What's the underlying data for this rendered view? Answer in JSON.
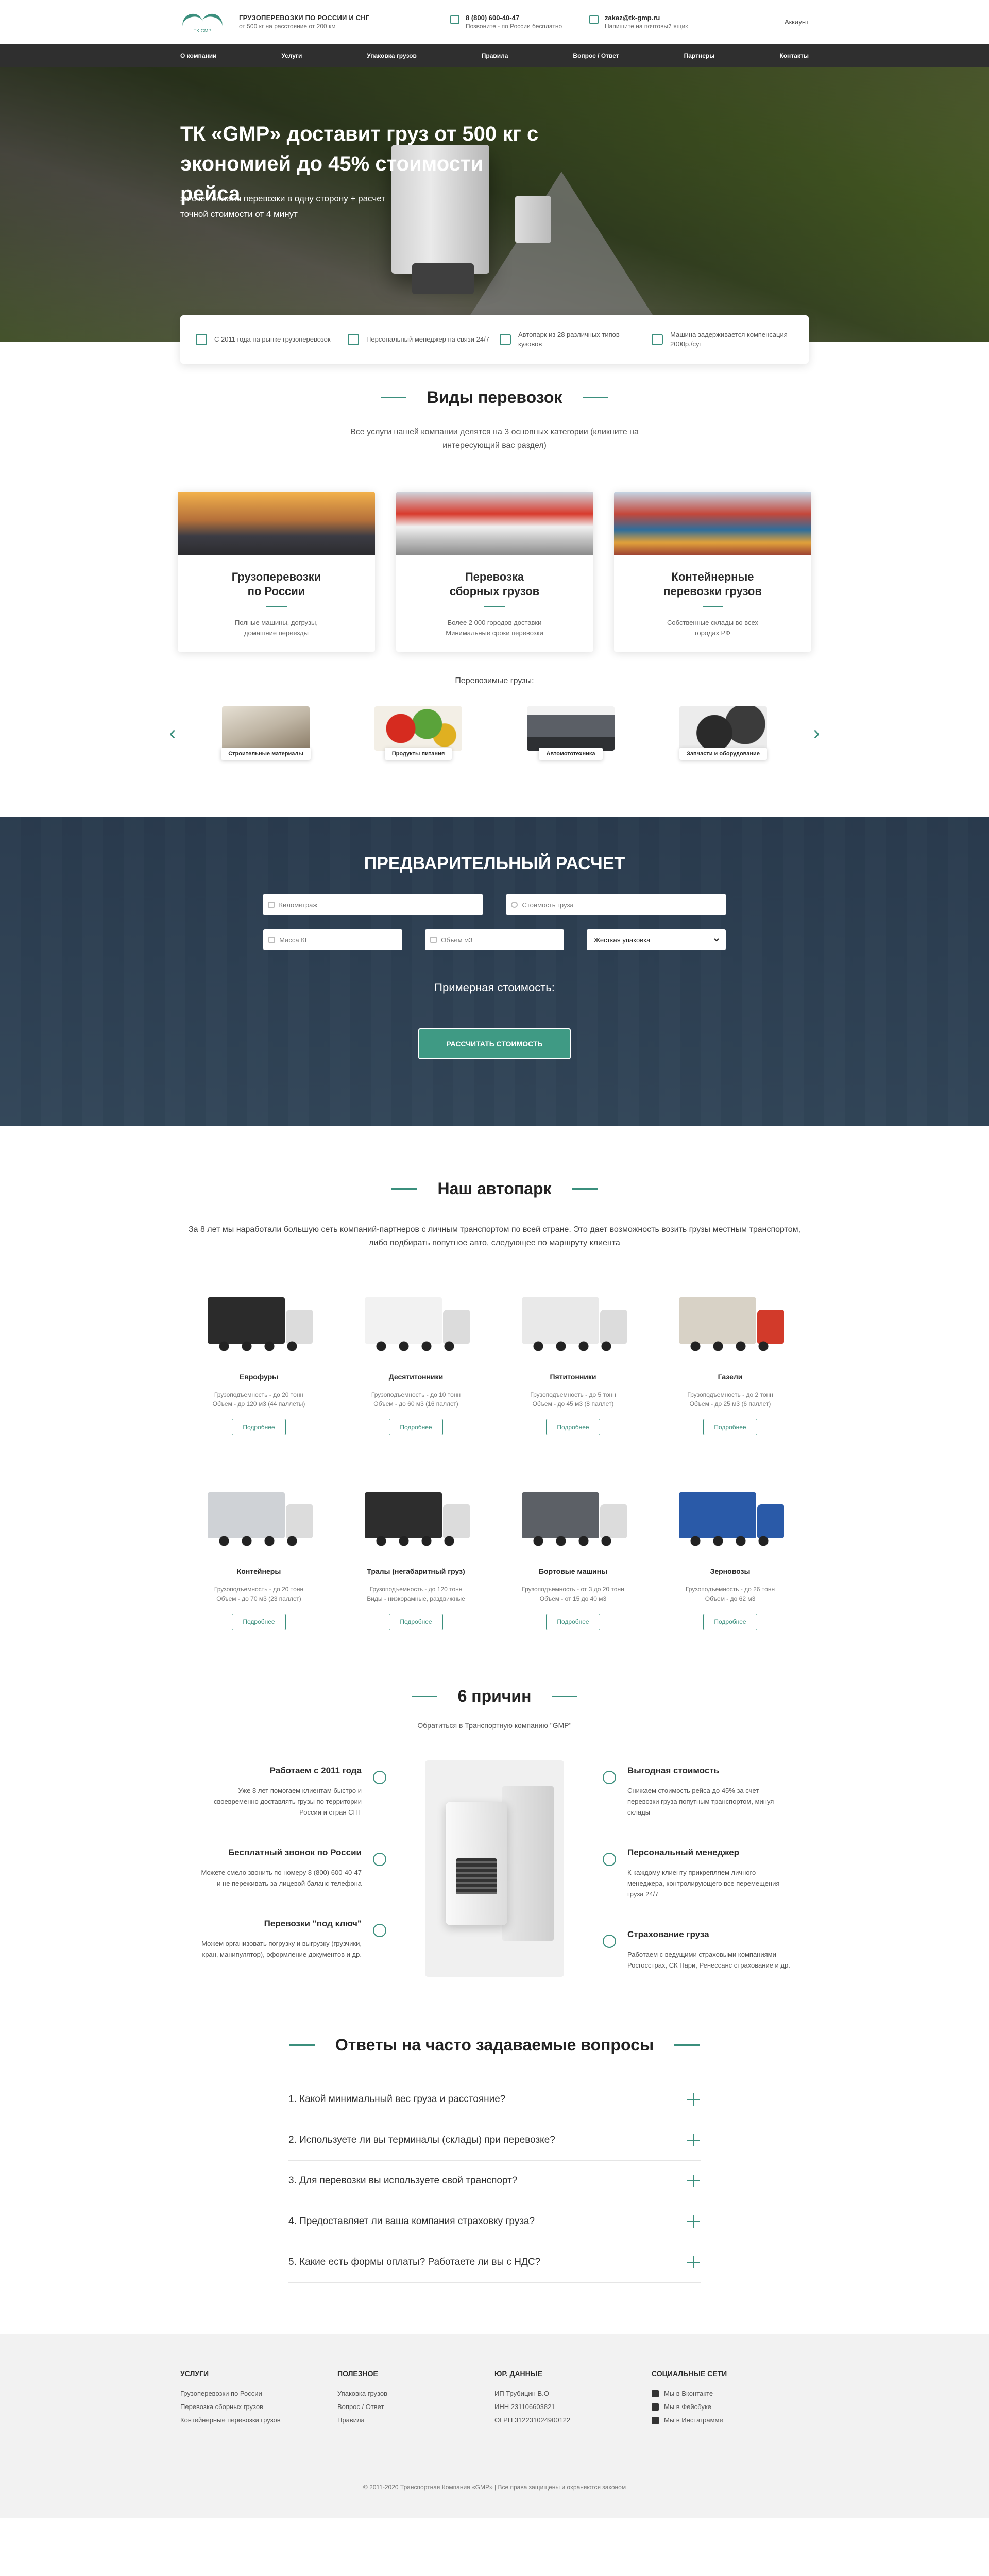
{
  "header": {
    "logo_text": "TK GMP",
    "brand_title": "ГРУЗОПЕРЕВОЗКИ ПО РОССИИ И СНГ",
    "brand_sub": "от 500 кг на расстояние от 200 км",
    "phone": "8 (800) 600-40-47",
    "phone_sub": "Позвоните - по России бесплатно",
    "email": "zakaz@tk-gmp.ru",
    "email_sub": "Напишите на почтовый ящик",
    "account": "Аккаунт"
  },
  "nav": [
    "О компании",
    "Услуги",
    "Упаковка грузов",
    "Правила",
    "Вопрос / Ответ",
    "Партнеры",
    "Контакты"
  ],
  "hero": {
    "title": "ТК «GMP» доставит груз от 500 кг с экономией до 45% стоимости рейса",
    "subtitle": "за счет оплаты перевозки в одну сторону + расчет точной стоимости от 4 минут"
  },
  "features": [
    "С 2011 года на рынке грузоперевозок",
    "Персональный менеджер на связи 24/7",
    "Автопарк из 28 различных типов кузовов",
    "Машина задерживается компенсация 2000р./сут"
  ],
  "types": {
    "title": "Виды перевозок",
    "subtitle": "Все услуги нашей компании делятся на 3 основных категории (кликните на интересующий вас раздел)",
    "cards": [
      {
        "title": "Грузоперевозки по России",
        "desc": "Полные машины, догрузы, домашние переезды"
      },
      {
        "title": "Перевозка сборных грузов",
        "desc": "Более 2 000 городов доставки Минимальные сроки перевозки"
      },
      {
        "title": "Контейнерные перевозки грузов",
        "desc": "Собственные склады во всех городах РФ"
      }
    ],
    "cargo_title": "Перевозимые грузы:",
    "cargo": [
      "Строительные материалы",
      "Продукты питания",
      "Автомототехника",
      "Запчасти и оборудование"
    ]
  },
  "calc": {
    "title": "ПРЕДВАРИТЕЛЬНЫЙ РАСЧЕТ",
    "km_placeholder": "Километраж",
    "cost_placeholder": "Стоимость груза",
    "mass_placeholder": "Масса КГ",
    "volume_placeholder": "Объем м3",
    "package_value": "Жесткая упаковка",
    "approx": "Примерная стоимость:",
    "button": "РАССЧИТАТЬ СТОИМОСТЬ"
  },
  "fleet": {
    "title": "Наш автопарк",
    "subtitle": "За 8 лет мы наработали большую сеть компаний-партнеров с личным транспортом по всей стране. Это дает возможность возить грузы местным транспортом, либо подбирать попутное авто, следующее по маршруту клиента",
    "more_label": "Подробнее",
    "items": [
      {
        "name": "Еврофуры",
        "l1": "Грузоподъемность - до 20 тонн",
        "l2": "Объем - до 120 м3 (44 паллеты)",
        "color": "#2b2b2b"
      },
      {
        "name": "Десятитонники",
        "l1": "Грузоподъемность - до 10 тонн",
        "l2": "Объем - до 60 м3 (16 паллет)",
        "color": "#f2f2f2"
      },
      {
        "name": "Пятитонники",
        "l1": "Грузоподъемность - до 5 тонн",
        "l2": "Объем - до 45 м3 (8 паллет)",
        "color": "#e9e9e9"
      },
      {
        "name": "Газели",
        "l1": "Грузоподъемность - до 2 тонн",
        "l2": "Объем - до 25 м3 (6 паллет)",
        "color": "#d8d2c6"
      },
      {
        "name": "Контейнеры",
        "l1": "Грузоподъемность - до 20 тонн",
        "l2": "Объем - до 70 м3 (23 паллет)",
        "color": "#cfd2d6"
      },
      {
        "name": "Тралы (негабаритный груз)",
        "l1": "Грузоподъемность - до 120 тонн",
        "l2": "Виды - низкорамные, раздвижные",
        "color": "#2d2d2d"
      },
      {
        "name": "Бортовые машины",
        "l1": "Грузоподъемность - от 3 до 20 тонн",
        "l2": "Объем - от 15 до 40 м3",
        "color": "#5c6066"
      },
      {
        "name": "Зерновозы",
        "l1": "Грузоподъемность - до 26 тонн",
        "l2": "Объем - до 62 м3",
        "color": "#2a5aa8"
      }
    ]
  },
  "reasons": {
    "title": "6 причин",
    "subtitle": "Обратиться в Транспортную компанию \"GMP\"",
    "left": [
      {
        "title": "Работаем с 2011 года",
        "text": "Уже 8 лет помогаем клиентам быстро и своевременно доставлять грузы по территории России и стран СНГ"
      },
      {
        "title": "Бесплатный звонок по России",
        "text": "Можете смело звонить по номеру 8 (800) 600-40-47 и не переживать за лицевой баланс телефона"
      },
      {
        "title": "Перевозки \"под ключ\"",
        "text": "Можем организовать погрузку и выгрузку (грузчики, кран, манипулятор), оформление документов и др."
      }
    ],
    "right": [
      {
        "title": "Выгодная стоимость",
        "text": "Снижаем стоимость рейса до 45% за счет перевозки груза попутным транспортом, минуя склады"
      },
      {
        "title": "Персональный менеджер",
        "text": "К каждому клиенту прикрепляем личного менеджера, контролирующего все перемещения груза 24/7"
      },
      {
        "title": "Страхование груза",
        "text": "Работаем с ведущими страховыми компаниями – Росгосстрах, СК Пари, Ренессанс страхование и др."
      }
    ]
  },
  "faq": {
    "title": "Ответы на часто задаваемые вопросы",
    "items": [
      "1. Какой минимальный вес груза и расстояние?",
      "2. Используете ли вы терминалы (склады) при перевозке?",
      "3. Для перевозки вы используете свой транспорт?",
      "4. Предоставляет ли ваша компания страховку груза?",
      "5. Какие есть формы оплаты? Работаете ли вы с НДС?"
    ]
  },
  "footer": {
    "col1_title": "УСЛУГИ",
    "col1": [
      "Грузоперевозки по России",
      "Перевозка сборных грузов",
      "Контейнерные перевозки грузов"
    ],
    "col2_title": "ПОЛЕЗНОЕ",
    "col2": [
      "Упаковка грузов",
      "Вопрос / Ответ",
      "Правила"
    ],
    "col3_title": "ЮР. ДАННЫЕ",
    "col3": [
      "ИП Трубицин В.О",
      "ИНН 231106603821",
      "ОГРН 312231024900122"
    ],
    "col4_title": "СОЦИАЛЬНЫЕ СЕТИ",
    "col4": [
      "Мы в Вконтакте",
      "Мы в Фейсбуке",
      "Мы в Инстаграмме"
    ],
    "copyright": "© 2011-2020 Транспортная Компания «GMP» | Все права защищены и охраняются законом"
  }
}
